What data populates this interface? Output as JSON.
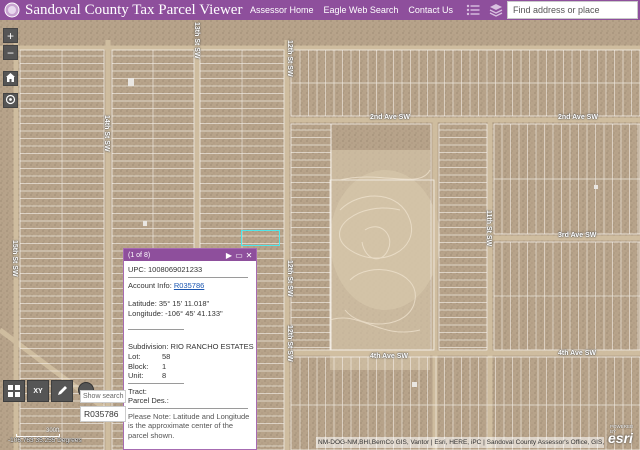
{
  "header": {
    "title": "Sandoval County Tax Parcel Viewer",
    "nav": [
      {
        "label": "Assessor Home"
      },
      {
        "label": "Eagle Web Search"
      },
      {
        "label": "Contact Us"
      }
    ],
    "search_placeholder": "Find address or place",
    "colors": {
      "header_bg": "#8e4f9c"
    }
  },
  "map_controls": {
    "zoom_in": "+",
    "zoom_out": "−",
    "home_icon": "home-icon",
    "locate_icon": "locate-icon"
  },
  "streets": {
    "second_ave_a": "2nd Ave SW",
    "second_ave_b": "2nd Ave SW",
    "third_ave": "3rd Ave SW",
    "fourth_ave_a": "4th Ave SW",
    "fourth_ave_b": "4th Ave SW",
    "st_a": "14th St SW",
    "st_b": "13th St SW",
    "st_c": "12th St SW",
    "st_d": "12th St SW",
    "st_e": "11th St SW",
    "st_f": "15th St SW",
    "st_g": "12th St SW"
  },
  "popup": {
    "counter": "(1 of 8)",
    "upc": "UPC: 1008069021233",
    "account_label": "Account Info: ",
    "account_link": "R035786",
    "latitude": "Latitude: 35° 15' 11.018\"",
    "longitude": "Longitude: -106° 45' 41.133\"",
    "subdivision": "Subdivision: RIO RANCHO ESTATES",
    "lot_label": "Lot:",
    "lot_value": "58",
    "block_label": "Block:",
    "block_value": "1",
    "unit_label": "Unit:",
    "unit_value": "8",
    "tract_label": "Tract:",
    "parcel_label": "Parcel Des.:",
    "note": "Please Note: Latitude and Longitude is the approximate center of the parcel shown."
  },
  "search_results": {
    "placeholder": "Show search re",
    "value": "R035786"
  },
  "tools": {
    "xy_label": "XY"
  },
  "scale": {
    "label": "300ft"
  },
  "coords": "-106.763 35.255 Degrees",
  "attribution": "NM-DOG-NM,BHI,BernCo GIS, Vantor | Esri, HERE, iPC | Sandoval County Assessor's Office, GIS, ...",
  "powered_by": "POWERED BY",
  "esri": "esri"
}
